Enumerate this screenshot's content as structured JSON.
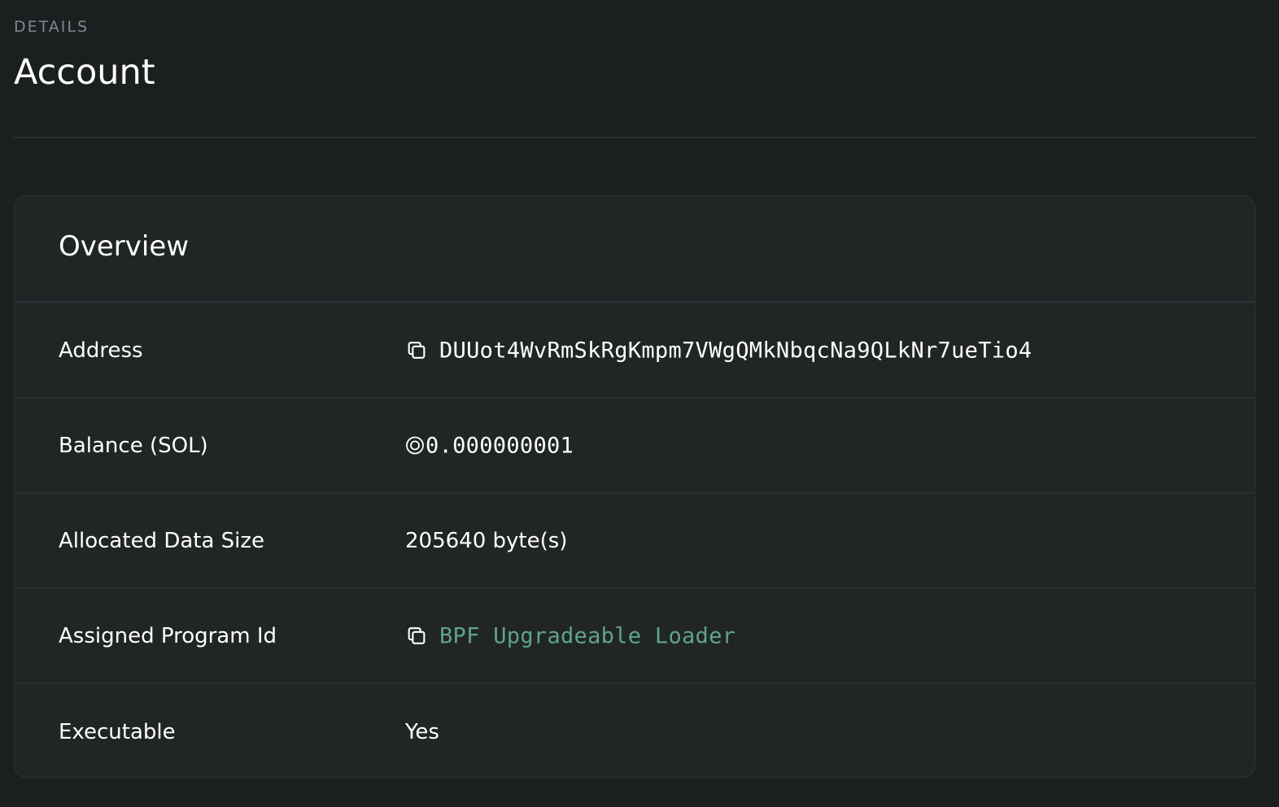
{
  "header": {
    "pretitle": "DETAILS",
    "title": "Account"
  },
  "overview": {
    "title": "Overview",
    "rows": [
      {
        "label": "Address",
        "value": "DUUot4WvRmSkRgKmpm7VWgQMkNbqcNa9QLkNr7ueTio4"
      },
      {
        "label": "Balance (SOL)",
        "value": "0.000000001"
      },
      {
        "label": "Allocated Data Size",
        "value": "205640 byte(s)"
      },
      {
        "label": "Assigned Program Id",
        "value": "BPF Upgradeable Loader"
      },
      {
        "label": "Executable",
        "value": "Yes"
      }
    ]
  },
  "colors": {
    "background": "#1b1f20",
    "card": "#212526",
    "link": "#5fa486",
    "muted": "#7d8a8e"
  }
}
